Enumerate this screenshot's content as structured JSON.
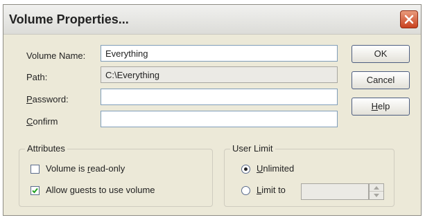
{
  "window": {
    "title": "Volume Properties...",
    "close_icon": "close-x-icon"
  },
  "form": {
    "volume_name_label": "Volume Name:",
    "volume_name_value": "Everything",
    "path_label": "Path:",
    "path_value": "C:\\Everything",
    "password_label_key": "P",
    "password_label_rest": "assword:",
    "password_value": "",
    "confirm_label_key": "C",
    "confirm_label_rest": "onfirm",
    "confirm_value": ""
  },
  "buttons": {
    "ok": "OK",
    "cancel": "Cancel",
    "help_key": "H",
    "help_rest": "elp"
  },
  "attributes": {
    "group_label": "Attributes",
    "readonly_pre": "Volume is ",
    "readonly_key": "r",
    "readonly_post": "ead-only",
    "readonly_checked": false,
    "guests_pre": "Allow ",
    "guests_key": "g",
    "guests_post": "uests to use volume",
    "guests_checked": true
  },
  "user_limit": {
    "group_label": "User Limit",
    "unlimited_key": "U",
    "unlimited_rest": "nlimited",
    "unlimited_selected": true,
    "limit_key": "L",
    "limit_rest": "imit to",
    "limit_selected": false,
    "limit_value": ""
  },
  "colors": {
    "dialog_bg": "#ece9d8",
    "close_button": "#c9411f"
  }
}
